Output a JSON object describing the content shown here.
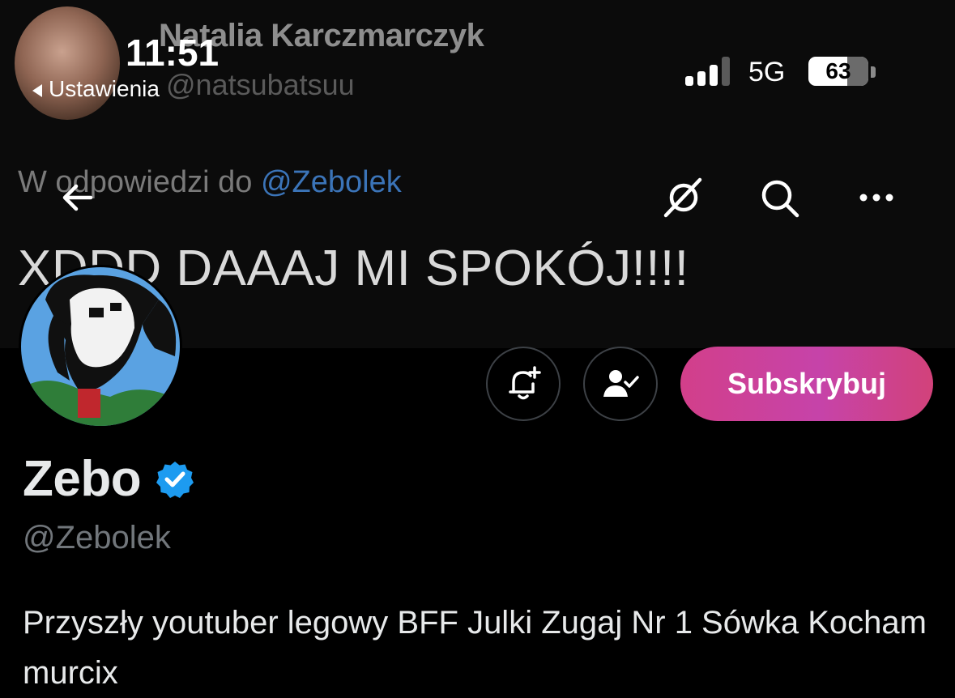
{
  "status_bar": {
    "time": "11:51",
    "back_app": "Ustawienia",
    "network": "5G",
    "battery": "63",
    "signal_bars": 3
  },
  "banner": {
    "name": "Natalia Karczmarczyk",
    "handle": "@natsubatsuu",
    "reply_prefix": "W odpowiedzi do",
    "reply_mention": "@Zebolek",
    "text": "XDDD DAAAJ MI SPOKÓJ!!!!"
  },
  "nav": {
    "icons": [
      "back-arrow-icon",
      "grok-icon",
      "search-icon",
      "more-icon"
    ]
  },
  "actions": {
    "subscribe_label": "Subskrybuj"
  },
  "profile": {
    "name": "Zebo",
    "handle": "@Zebolek",
    "bio": "Przyszły youtuber legowy BFF Julki Zugaj Nr 1 Sówka Kocham murcix"
  },
  "colors": {
    "background": "#000000",
    "verified": "#1d9bf0",
    "subscribe_start": "#d23f8a",
    "subscribe_end": "#c643a9",
    "mention": "#3b74b8"
  }
}
